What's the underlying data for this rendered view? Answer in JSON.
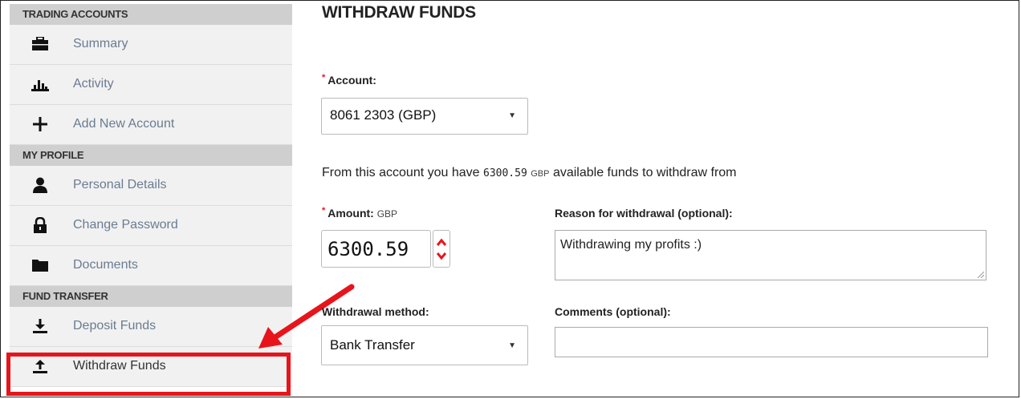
{
  "sidebar": {
    "sections": [
      {
        "title": "TRADING ACCOUNTS",
        "items": [
          {
            "label": "Summary",
            "icon": "briefcase-icon"
          },
          {
            "label": "Activity",
            "icon": "bar-chart-icon"
          },
          {
            "label": "Add New Account",
            "icon": "plus-icon"
          }
        ]
      },
      {
        "title": "MY PROFILE",
        "items": [
          {
            "label": "Personal Details",
            "icon": "user-icon"
          },
          {
            "label": "Change Password",
            "icon": "lock-icon"
          },
          {
            "label": "Documents",
            "icon": "folder-icon"
          }
        ]
      },
      {
        "title": "FUND TRANSFER",
        "items": [
          {
            "label": "Deposit Funds",
            "icon": "download-icon"
          },
          {
            "label": "Withdraw Funds",
            "icon": "upload-icon"
          }
        ]
      }
    ]
  },
  "main": {
    "title": "WITHDRAW FUNDS",
    "required_marker": "*",
    "account": {
      "label": "Account:",
      "value": "8061 2303 (GBP)"
    },
    "available": {
      "prefix": "From this account you have",
      "amount": "6300.59",
      "currency": "GBP",
      "suffix": "available funds to withdraw from"
    },
    "amount": {
      "label": "Amount:",
      "unit": "GBP",
      "value": "6300.59"
    },
    "reason": {
      "label": "Reason for withdrawal (optional):",
      "value": "Withdrawing my profits :)"
    },
    "method": {
      "label": "Withdrawal method:",
      "value": "Bank Transfer"
    },
    "comments": {
      "label": "Comments (optional):",
      "value": ""
    }
  },
  "colors": {
    "accent_red": "#e8141b",
    "link_blue_grey": "#6a7c91",
    "section_header_bg": "#cfcfcf",
    "item_bg": "#f1f1f1"
  }
}
